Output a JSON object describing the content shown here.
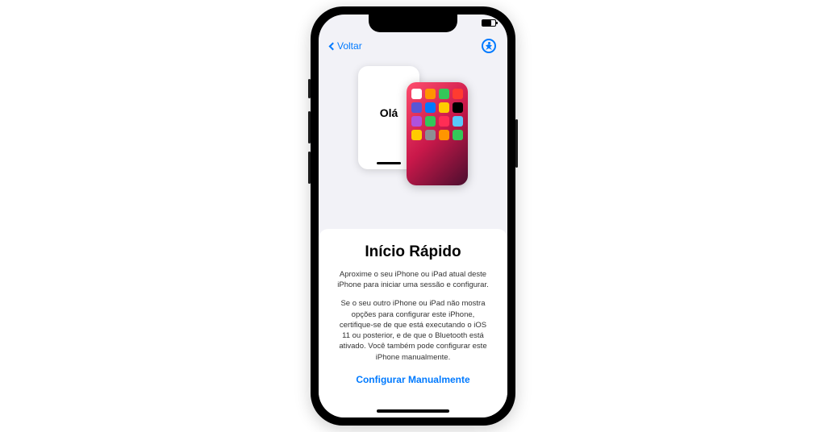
{
  "nav": {
    "back_label": "Voltar"
  },
  "illustration": {
    "greeting": "Olá",
    "app_colors": [
      "#fff",
      "#ff9500",
      "#34c759",
      "#ff3b30",
      "#5856d6",
      "#007aff",
      "#ffcc00",
      "#000",
      "#af52de",
      "#34c759",
      "#ff2d55",
      "#5ac8fa",
      "#ffcc00",
      "#8e8e93",
      "#ff9500",
      "#34c759"
    ]
  },
  "content": {
    "title": "Início Rápido",
    "description1": "Aproxime o seu iPhone ou iPad atual deste iPhone para iniciar uma sessão e configurar.",
    "description2": "Se o seu outro iPhone ou iPad não mostra opções para configurar este iPhone, certifique-se de que está executando o iOS 11 ou posterior, e de que o Bluetooth está ativado. Você também pode configurar este iPhone manualmente.",
    "manual_label": "Configurar Manualmente"
  }
}
